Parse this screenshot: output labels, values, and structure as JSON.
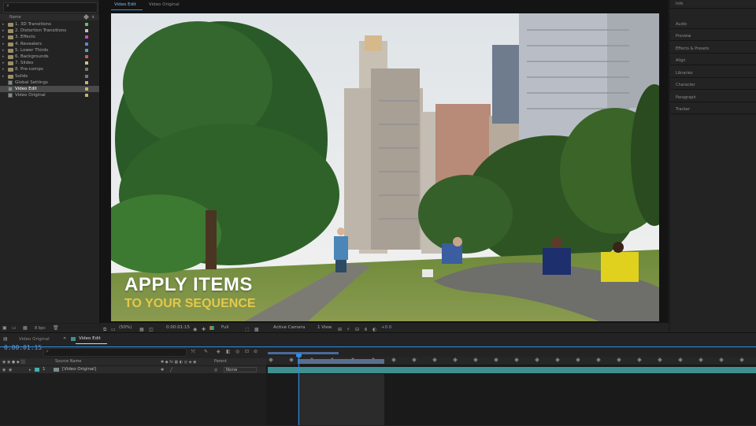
{
  "project": {
    "search_glyph": "⌕",
    "column_name": "Name",
    "items": [
      {
        "label": "1. 3D Transitions",
        "type": "folder",
        "swatch": "#5dbf6b"
      },
      {
        "label": "2. Distortion Transitions",
        "type": "folder",
        "swatch": "#c0c0c0"
      },
      {
        "label": "3. Effects",
        "type": "folder",
        "swatch": "#c04ac8"
      },
      {
        "label": "4. Revealers",
        "type": "folder",
        "swatch": "#6a7fd0"
      },
      {
        "label": "5. Lower Thirds",
        "type": "folder",
        "swatch": "#4fa0c8"
      },
      {
        "label": "6. Backgrounds",
        "type": "folder",
        "swatch": "#d05a4a"
      },
      {
        "label": "7. Slides",
        "type": "folder",
        "swatch": "#d4c080"
      },
      {
        "label": "8. Pre-comps",
        "type": "folder",
        "swatch": "#777777"
      },
      {
        "label": "Solids",
        "type": "folder",
        "swatch": "#777777"
      },
      {
        "label": "Global Settings",
        "type": "comp",
        "swatch": "#c8b070"
      },
      {
        "label": "Video Edit",
        "type": "comp",
        "swatch": "#c8b070",
        "selected": true
      },
      {
        "label": "Video Original",
        "type": "comp",
        "swatch": "#c8b070"
      }
    ],
    "bpc": "8 bpc"
  },
  "viewer": {
    "tabs": [
      "Video Edit",
      "Video Original"
    ],
    "overlay_line1": "APPLY ITEMS",
    "overlay_line2": "TO YOUR SEQUENCE",
    "zoom": "(50%)",
    "timecode": "0:00:01:15",
    "resolution": "Full",
    "camera": "Active Camera",
    "views": "1 View",
    "offset": "+0.0"
  },
  "right_panels": [
    "Info",
    "Audio",
    "Preview",
    "Effects & Presets",
    "Align",
    "Libraries",
    "Character",
    "Paragraph",
    "Tracker"
  ],
  "timeline": {
    "tabs": [
      "Video Original",
      "Video Edit"
    ],
    "timecode": "0:00:01:15",
    "search_placeholder": "⌕",
    "col_source": "Source Name",
    "col_parent": "Parent",
    "layer": {
      "number": "1",
      "name": "[Video Original]",
      "parent": "None"
    }
  },
  "colors": {
    "accent": "#2d8ceb",
    "track": "#3e8f8f",
    "selected_row": "#4a4a4a"
  }
}
